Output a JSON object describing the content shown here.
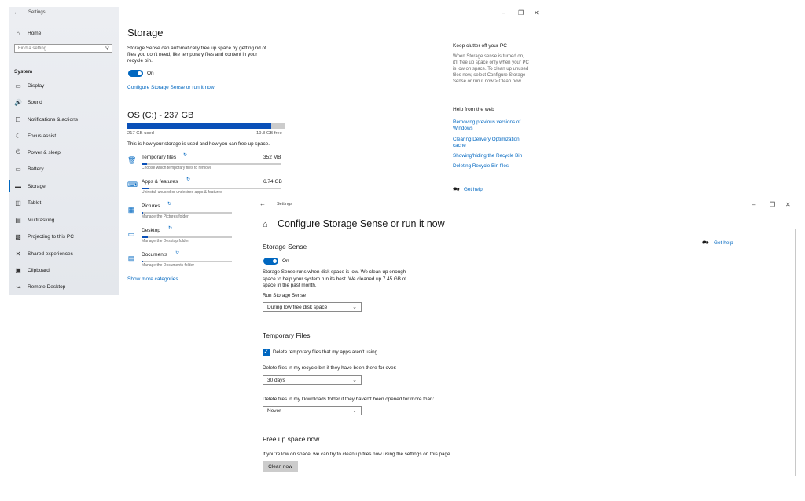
{
  "back_window": {
    "title": "Settings",
    "sidebar": {
      "home": "Home",
      "search_placeholder": "Find a setting",
      "section": "System",
      "items": [
        "Display",
        "Sound",
        "Notifications & actions",
        "Focus assist",
        "Power & sleep",
        "Battery",
        "Storage",
        "Tablet",
        "Multitasking",
        "Projecting to this PC",
        "Shared experiences",
        "Clipboard",
        "Remote Desktop"
      ],
      "active": "Storage"
    },
    "main": {
      "title": "Storage",
      "description_lines": [
        "Storage Sense can automatically free up space by getting rid of",
        "files you don't need, like temporary files and content in your",
        "recycle bin."
      ],
      "toggle_label": "On",
      "configure_link": "Configure Storage Sense or run it now",
      "drive_title": "OS (C:) - 237 GB",
      "used_label": "217 GB used",
      "free_label": "19.8 GB free",
      "used_fraction": 0.916,
      "usage_intro": "This is how your storage is used and how you can free up space.",
      "categories": [
        {
          "name": "Temporary files",
          "size": "352 MB",
          "hint": "Choose which temporary files to remove",
          "fill": 0.04
        },
        {
          "name": "Apps & features",
          "size": "6.74 GB",
          "hint": "Uninstall unused or undesired apps & features",
          "fill": 0.05
        },
        {
          "name": "Pictures",
          "size": "",
          "hint": "Manage the Pictures folder",
          "fill": 0.02
        },
        {
          "name": "Desktop",
          "size": "",
          "hint": "Manage the Desktop folder",
          "fill": 0.07
        },
        {
          "name": "Documents",
          "size": "",
          "hint": "Manage the Documents folder",
          "fill": 0.02
        }
      ],
      "show_more": "Show more categories"
    },
    "right": {
      "clutter_title": "Keep clutter off your PC",
      "clutter_lines": [
        "When Storage sense is turned on,",
        "it'll free up space only when your PC",
        "is low on space. To clean up unused",
        "files now, select Configure Storage",
        "Sense or run it now > Clean now."
      ],
      "help_title": "Help from the web",
      "help_links": [
        "Removing previous versions of",
        "Windows",
        "Clearing Delivery Optimization",
        "cache",
        "Showing/hiding the Recycle Bin",
        "Deleting Recycle Bin files"
      ],
      "get_help": "Get help"
    }
  },
  "front_window": {
    "title": "Settings",
    "page_title": "Configure Storage Sense or run it now",
    "get_help": "Get help",
    "storage_sense": {
      "heading": "Storage Sense",
      "toggle_label": "On",
      "description_lines": [
        "Storage Sense runs when disk space is low. We clean up enough",
        "space to help your system run its best. We cleaned up 7.45 GB of",
        "space in the past month."
      ],
      "run_label": "Run Storage Sense",
      "run_value": "During low free disk space"
    },
    "temporary_files": {
      "heading": "Temporary Files",
      "checkbox_label": "Delete temporary files that my apps aren't using",
      "recycle_label": "Delete files in my recycle bin if they have been there for over:",
      "recycle_value": "30 days",
      "downloads_label": "Delete files in my Downloads folder if they haven't been opened for more than:",
      "downloads_value": "Never"
    },
    "free_up": {
      "heading": "Free up space now",
      "description": "If you're low on space, we can try to clean up files now using the settings on this page.",
      "button": "Clean now"
    }
  }
}
